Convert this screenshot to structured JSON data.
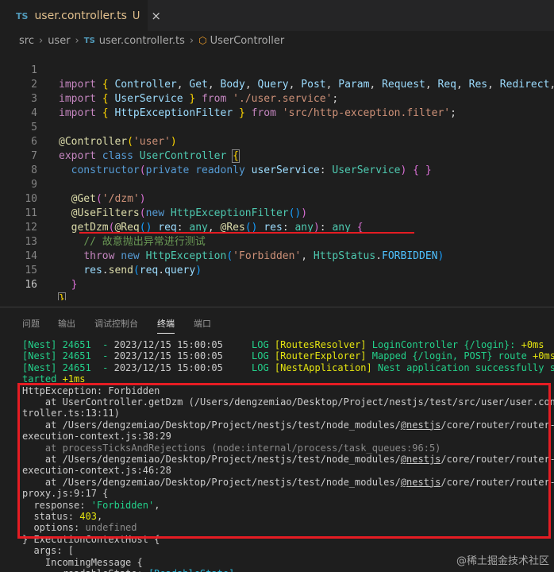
{
  "tab": {
    "icon": "TS",
    "filename": "user.controller.ts",
    "status": "U",
    "close_icon": "×"
  },
  "breadcrumb": {
    "items": [
      "src",
      "user",
      "user.controller.ts",
      "UserController"
    ],
    "ts_icon": "TS"
  },
  "editor": {
    "line_numbers": [
      "1",
      "2",
      "3",
      "4",
      "5",
      "6",
      "7",
      "8",
      "9",
      "10",
      "11",
      "12",
      "13",
      "14",
      "15",
      "16"
    ],
    "comment_text": "// 故意抛出异常进行测试"
  },
  "panel": {
    "tabs": [
      "问题",
      "输出",
      "调试控制台",
      "终端",
      "端口"
    ],
    "active_tab": "终端"
  },
  "terminal": {
    "lines": [
      "[Nest] 24651  - 2023/12/15 15:00:05     LOG [RoutesResolver] LoginController {/login}: +0ms",
      "[Nest] 24651  - 2023/12/15 15:00:05     LOG [RouterExplorer] Mapped {/login, POST} route +0ms",
      "[Nest] 24651  - 2023/12/15 15:00:05     LOG [NestApplication] Nest application successfully s",
      "tarted +1ms",
      "HttpException: Forbidden",
      "    at UserController.getDzm (/Users/dengzemiao/Desktop/Project/nestjs/test/src/user/user.con",
      "troller.ts:13:11)",
      "    at /Users/dengzemiao/Desktop/Project/nestjs/test/node_modules/@nestjs/core/router/router-",
      "execution-context.js:38:29",
      "    at processTicksAndRejections (node:internal/process/task_queues:96:5)",
      "    at /Users/dengzemiao/Desktop/Project/nestjs/test/node_modules/@nestjs/core/router/router-",
      "execution-context.js:46:28",
      "    at /Users/dengzemiao/Desktop/Project/nestjs/test/node_modules/@nestjs/core/router/router-",
      "proxy.js:9:17 {",
      "  response: 'Forbidden',",
      "  status: 403,",
      "  options: undefined",
      "} ExecutionContextHost {",
      "  args: [",
      "    IncomingMessage {",
      "      _readableState: [ReadableState],"
    ]
  },
  "watermark": "@稀土掘金技术社区",
  "colors": {
    "background": "#1e1e1e",
    "highlight_red": "#e51c23",
    "keyword": "#569cd6",
    "string": "#ce9178",
    "type": "#4ec9b0"
  }
}
